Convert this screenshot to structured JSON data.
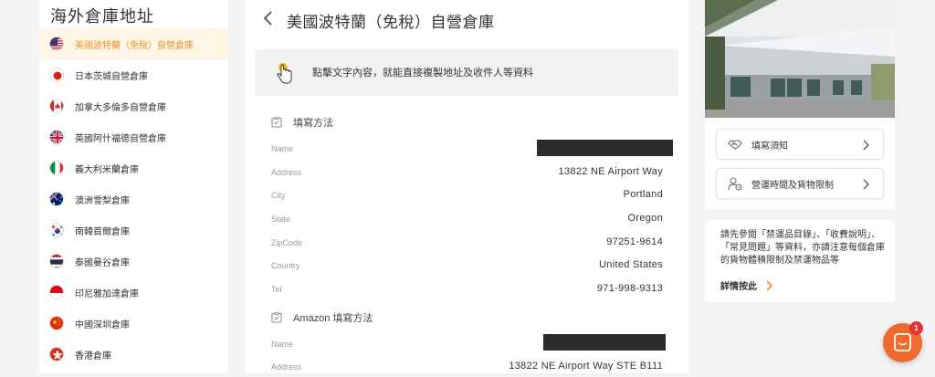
{
  "sidebar": {
    "title": "海外倉庫地址",
    "items": [
      {
        "label": "美國波特蘭（免稅）自營倉庫",
        "flag": "us-flag-icon"
      },
      {
        "label": "日本茨城自營倉庫",
        "flag": "japan-flag-icon"
      },
      {
        "label": "加拿大多倫多自營倉庫",
        "flag": "canada-flag-icon"
      },
      {
        "label": "英國阿什福德自營倉庫",
        "flag": "uk-flag-icon"
      },
      {
        "label": "義大利米蘭倉庫",
        "flag": "italy-flag-icon"
      },
      {
        "label": "澳洲雪梨倉庫",
        "flag": "australia-flag-icon"
      },
      {
        "label": "南韓首爾倉庫",
        "flag": "korea-flag-icon"
      },
      {
        "label": "泰國曼谷倉庫",
        "flag": "thailand-flag-icon"
      },
      {
        "label": "印尼雅加達倉庫",
        "flag": "indonesia-flag-icon"
      },
      {
        "label": "中國深圳倉庫",
        "flag": "china-flag-icon"
      },
      {
        "label": "香港倉庫",
        "flag": "hongkong-flag-icon"
      }
    ]
  },
  "main": {
    "title": "美國波特蘭（免稅）自營倉庫",
    "hint": "點擊文字內容，就能直接複製地址及收件人等資料",
    "sections": [
      {
        "heading": "填寫方法",
        "rows": [
          {
            "label": "Name",
            "value": ""
          },
          {
            "label": "Address",
            "value": "13822 NE Airport Way"
          },
          {
            "label": "City",
            "value": "Portland"
          },
          {
            "label": "State",
            "value": "Oregon"
          },
          {
            "label": "ZipCode",
            "value": "97251-9614"
          },
          {
            "label": "Country",
            "value": "United States"
          },
          {
            "label": "Tel",
            "value": "971-998-9313"
          }
        ]
      },
      {
        "heading": "Amazon 填寫方法",
        "rows": [
          {
            "label": "Name",
            "value": ""
          },
          {
            "label": "Address",
            "value": "13822 NE Airport Way STE B111"
          }
        ]
      }
    ]
  },
  "right": {
    "links": [
      {
        "label": "填寫須知"
      },
      {
        "label": "營運時間及貨物限制"
      }
    ],
    "notice": "請先參閱「禁運品目錄」、「收費說明」、「常見問題」等資料，亦請注意每個倉庫的貨物體積限制及禁運物品等",
    "details_label": "詳情按此"
  },
  "chat": {
    "badge": "1"
  },
  "colors": {
    "accent": "#e8942a",
    "chat": "#f06a2f",
    "badge": "#e0363a"
  }
}
